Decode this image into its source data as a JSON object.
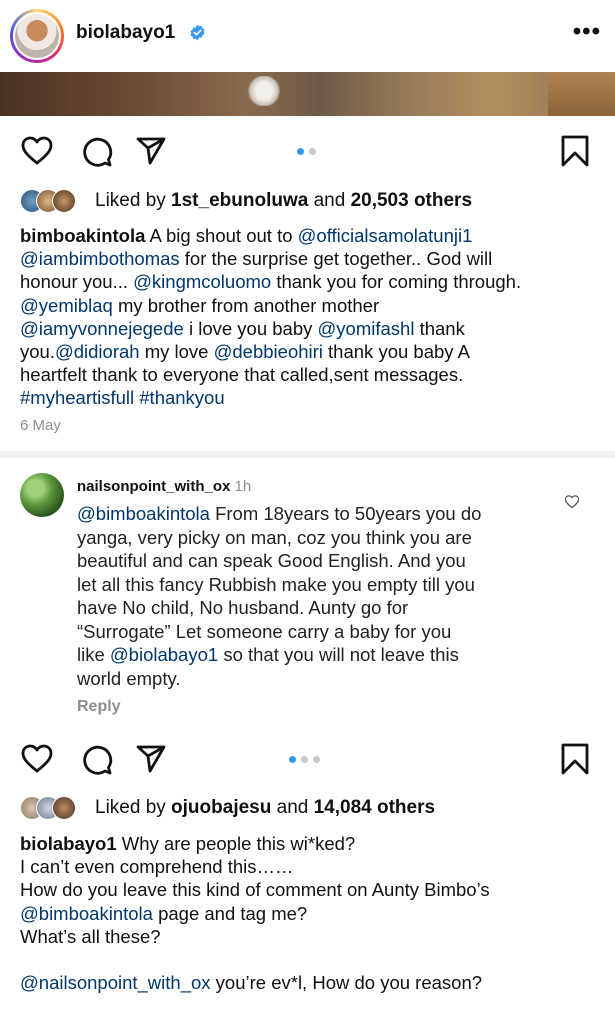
{
  "post1": {
    "username": "biolabayo1",
    "likes": {
      "prefix": "Liked by ",
      "name": "1st_ebunoluwa",
      "middle": " and ",
      "count": "20,503 others"
    },
    "caption_user": "bimboakintola",
    "caption_lines": [
      [
        {
          "t": " A big shout out to "
        },
        {
          "m": "@officialsamolatunji1"
        }
      ],
      [
        {
          "m": "@iambimbothomas"
        },
        {
          "t": "  for the surprise get together.. God will"
        }
      ],
      [
        {
          "t": "honour you... "
        },
        {
          "m": "@kingmcoluomo"
        },
        {
          "t": " thank you for coming through."
        }
      ],
      [
        {
          "m": "@yemiblaq"
        },
        {
          "t": "  my brother from another mother"
        }
      ],
      [
        {
          "m": "@iamyvonnejegede"
        },
        {
          "t": " i love you baby "
        },
        {
          "m": "@yomifashl"
        },
        {
          "t": " thank"
        }
      ],
      [
        {
          "t": "you."
        },
        {
          "m": "@didiorah"
        },
        {
          "t": " my love "
        },
        {
          "m": "@debbieohiri"
        },
        {
          "t": " thank you baby A"
        }
      ],
      [
        {
          "t": "heartfelt thank to everyone that called,sent messages."
        }
      ],
      [
        {
          "m": "#myheartisfull #thankyou"
        }
      ]
    ],
    "date": "6 May"
  },
  "comment": {
    "username": "nailsonpoint_with_ox",
    "time": "1h",
    "lines": [
      [
        {
          "m": "@bimboakintola"
        },
        {
          "t": " From 18years to 50years you do"
        }
      ],
      [
        {
          "t": "yanga, very picky on man, coz you think you are"
        }
      ],
      [
        {
          "t": "beautiful and can speak Good English. And you"
        }
      ],
      [
        {
          "t": "let all this fancy Rubbish make you empty till you"
        }
      ],
      [
        {
          "t": "have No child, No husband. Aunty go for"
        }
      ],
      [
        {
          "t": "“Surrogate” Let someone carry a baby for you"
        }
      ],
      [
        {
          "t": "like "
        },
        {
          "m": "@biolabayo1"
        },
        {
          "t": " so that you will not leave this"
        }
      ],
      [
        {
          "t": "world empty."
        }
      ]
    ],
    "reply_label": "Reply"
  },
  "post2": {
    "likes": {
      "prefix": "Liked by ",
      "name": "ojuobajesu",
      "middle": " and ",
      "count": "14,084 others"
    },
    "caption_user": "biolabayo1",
    "caption_lines": [
      [
        {
          "t": " Why are people this wi*ked?"
        }
      ],
      [
        {
          "t": " I can’t even comprehend this……"
        }
      ],
      [
        {
          "t": "How do you leave this kind of comment on Aunty Bimbo’s"
        }
      ],
      [
        {
          "m": "@bimboakintola"
        },
        {
          "t": " page and tag me?"
        }
      ],
      [
        {
          "t": "What’s all these?"
        }
      ],
      [],
      [
        {
          "m": "@nailsonpoint_with_ox"
        },
        {
          "t": " you’re ev*l, How do you reason?"
        }
      ]
    ]
  },
  "icons": {
    "like": "heart-icon",
    "comment": "comment-icon",
    "share": "send-icon",
    "save": "bookmark-icon",
    "verified": "verified-badge-icon",
    "more": "more-options-icon"
  },
  "colors": {
    "mention": "#00376b",
    "dot_active": "#3897f0",
    "verified": "#3897f0",
    "secondary_text": "#8e8e8e"
  },
  "carousel": {
    "post1_active": 1,
    "post1_total": 2,
    "post2_active": 1,
    "post2_total": 3
  }
}
